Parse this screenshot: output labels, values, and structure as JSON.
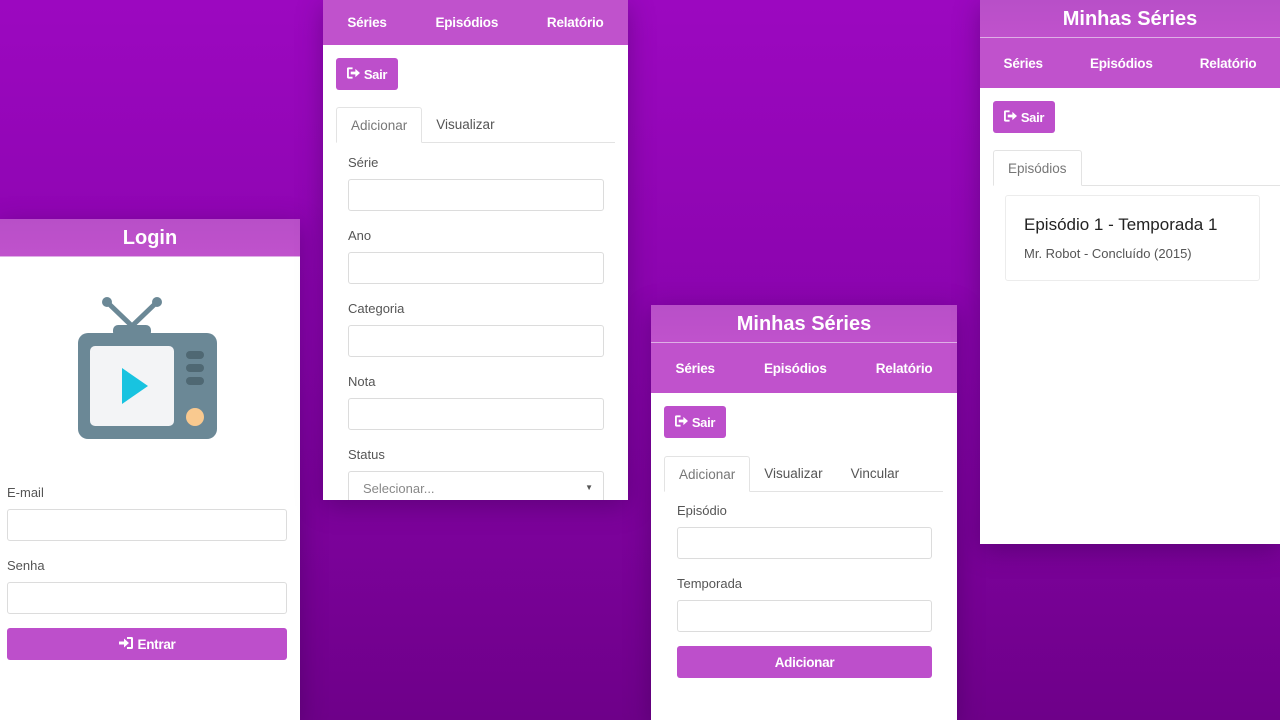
{
  "login": {
    "title": "Login",
    "email_label": "E-mail",
    "password_label": "Senha",
    "submit_label": "Entrar"
  },
  "series_form": {
    "nav": [
      "Séries",
      "Episódios",
      "Relatório"
    ],
    "logout_label": "Sair",
    "tabs": [
      "Adicionar",
      "Visualizar"
    ],
    "fields": {
      "serie_label": "Série",
      "ano_label": "Ano",
      "categoria_label": "Categoria",
      "nota_label": "Nota",
      "status_label": "Status",
      "status_placeholder": "Selecionar..."
    }
  },
  "episodes_form": {
    "title": "Minhas Séries",
    "nav": [
      "Séries",
      "Episódios",
      "Relatório"
    ],
    "logout_label": "Sair",
    "tabs": [
      "Adicionar",
      "Visualizar",
      "Vincular"
    ],
    "episode_label": "Episódio",
    "season_label": "Temporada",
    "submit_label": "Adicionar"
  },
  "episodes_view": {
    "title": "Minhas Séries",
    "nav": [
      "Séries",
      "Episódios",
      "Relatório"
    ],
    "logout_label": "Sair",
    "tab": "Episódios",
    "card": {
      "title": "Episódio 1 - Temporada 1",
      "subtitle": "Mr. Robot - Concluído (2015)"
    }
  },
  "colors": {
    "accent": "#c052cc",
    "button": "#bd4fcb",
    "background": "#8a04ad",
    "tv_body": "#6b8896",
    "tv_play": "#18c3e0",
    "tv_knob": "#f9c98f"
  },
  "icons": {
    "logout": "sign-out-icon",
    "login": "sign-in-icon",
    "tv": "tv-play-icon",
    "select_caret": "caret-down-icon"
  }
}
